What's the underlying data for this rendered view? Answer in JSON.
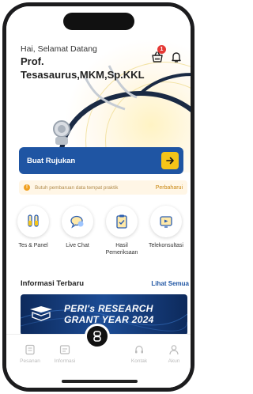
{
  "header": {
    "greeting": "Hai, Selamat Datang",
    "doctor_name": "Prof. Tesasaurus,MKM,Sp.KKL",
    "cart_count": "1"
  },
  "referral": {
    "label": "Buat Rujukan"
  },
  "notice": {
    "icon_text": "!",
    "text": "Butuh pembaruan data tempat praktik",
    "link": "Perbaharui"
  },
  "services": [
    {
      "label": "Tes & Panel",
      "icon": "test-tube-icon"
    },
    {
      "label": "Live Chat",
      "icon": "chat-icon"
    },
    {
      "label": "Hasil Pemeriksaan",
      "icon": "clipboard-icon"
    },
    {
      "label": "Telekonsultasi",
      "icon": "video-call-icon"
    }
  ],
  "info": {
    "title": "Informasi Terbaru",
    "see_all": "Lihat Semua",
    "banner_text": "PERI's RESEARCH GRANT YEAR 2024"
  },
  "bottom_nav": [
    {
      "label": "Pesanan",
      "icon": "orders-icon"
    },
    {
      "label": "Informasi",
      "icon": "info-icon"
    },
    {
      "label": "Kontak",
      "icon": "contact-icon"
    },
    {
      "label": "Akun",
      "icon": "account-icon"
    }
  ],
  "colors": {
    "primary": "#1f55a3",
    "accent": "#f5c518",
    "badge": "#e53935",
    "notice_bg": "#fff6e6"
  }
}
